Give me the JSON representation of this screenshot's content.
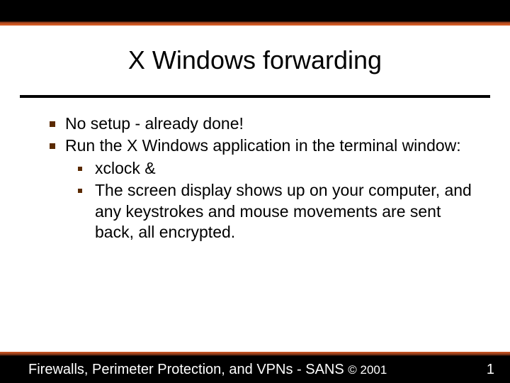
{
  "title": "X Windows forwarding",
  "bullets": {
    "b1": "No setup - already done!",
    "b2": "Run the X Windows application in the terminal window:",
    "sub1": "xclock &",
    "sub2": "The screen display shows up on your computer, and any keystrokes and mouse movements are sent back, all encrypted."
  },
  "footer": {
    "text": "Firewalls, Perimeter Protection, and VPNs - SANS ",
    "copyright": "© 2001",
    "page": "1"
  }
}
